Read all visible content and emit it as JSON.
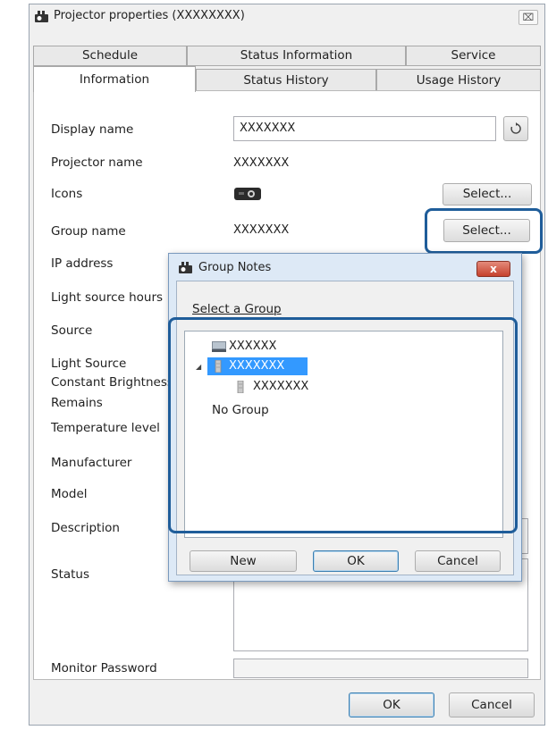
{
  "window": {
    "title": "Projector properties (XXXXXXXX)",
    "close_label": "⌧"
  },
  "tabs": {
    "row1": [
      "Schedule",
      "Status Information",
      "Service"
    ],
    "row2": [
      "Information",
      "Status History",
      "Usage History"
    ],
    "active": "Information"
  },
  "info": {
    "display_name_label": "Display name",
    "display_name_value": "XXXXXXX",
    "projector_name_label": "Projector name",
    "projector_name_value": "XXXXXXX",
    "icons_label": "Icons",
    "icons_select": "Select...",
    "group_name_label": "Group name",
    "group_name_value": "XXXXXXX",
    "group_select": "Select...",
    "ip_label": "IP address",
    "light_hours_label": "Light source hours",
    "source_label": "Source",
    "light_source_label": "Light Source",
    "constant_label": "Constant Brightness",
    "remains_label": "Remains",
    "temp_label": "Temperature level",
    "manufacturer_label": "Manufacturer",
    "model_label": "Model",
    "description_label": "Description",
    "status_label": "Status",
    "monitor_password_label": "Monitor Password"
  },
  "footer": {
    "ok_label": "OK",
    "cancel_label": "Cancel"
  },
  "dialog": {
    "title": "Group Notes",
    "close_label": "x",
    "select_group_label": "Select a Group",
    "tree": [
      {
        "label": "XXXXXX",
        "selected": false
      },
      {
        "label": "XXXXXXX",
        "selected": true
      },
      {
        "label": "XXXXXXX",
        "selected": false
      },
      {
        "label": "No Group",
        "selected": false
      }
    ],
    "new_label": "New",
    "ok_label": "OK",
    "cancel_label": "Cancel"
  }
}
